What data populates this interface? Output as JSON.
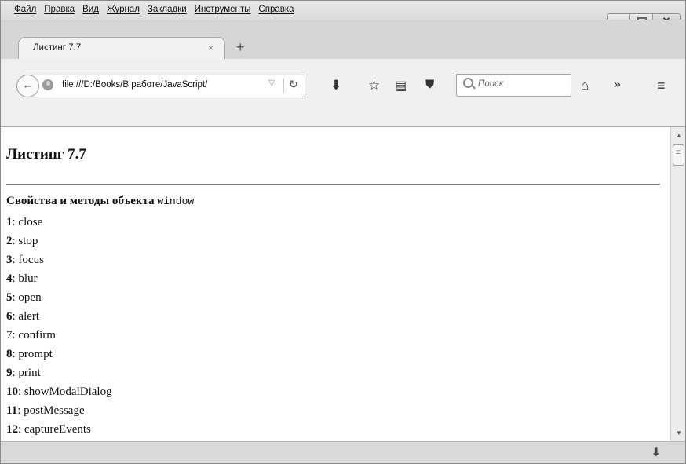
{
  "menu": {
    "items": [
      "Файл",
      "Правка",
      "Вид",
      "Журнал",
      "Закладки",
      "Инструменты",
      "Справка"
    ]
  },
  "tab": {
    "title": "Листинг 7.7",
    "close": "×",
    "new_tab": "+"
  },
  "navbar": {
    "url": "file:///D:/Books/В работе/JavaScript/",
    "search_placeholder": "Поиск"
  },
  "icons": {
    "back": "back-arrow-icon",
    "site": "globe-icon",
    "dropdown": "url-dropdown-icon",
    "reload": "reload-icon",
    "download": "download-icon",
    "bookmark": "star-icon",
    "reader": "reader-view-icon",
    "pocket": "pocket-icon",
    "search": "search-icon",
    "home": "home-icon",
    "overflow": "chevrons-right-icon",
    "menu": "hamburger-menu-icon"
  },
  "page": {
    "heading": "Листинг 7.7",
    "subtitle_text": "Свойства и методы объекта ",
    "subtitle_code": "window",
    "items": [
      {
        "num": "1",
        "name": "close"
      },
      {
        "num": "2",
        "name": "stop"
      },
      {
        "num": "3",
        "name": "focus"
      },
      {
        "num": "4",
        "name": "blur"
      },
      {
        "num": "5",
        "name": "open"
      },
      {
        "num": "6",
        "name": "alert"
      },
      {
        "num": "7",
        "name": "confirm"
      },
      {
        "num": "8",
        "name": "prompt"
      },
      {
        "num": "9",
        "name": "print"
      },
      {
        "num": "10",
        "name": "showModalDialog"
      },
      {
        "num": "11",
        "name": "postMessage"
      },
      {
        "num": "12",
        "name": "captureEvents"
      }
    ]
  }
}
